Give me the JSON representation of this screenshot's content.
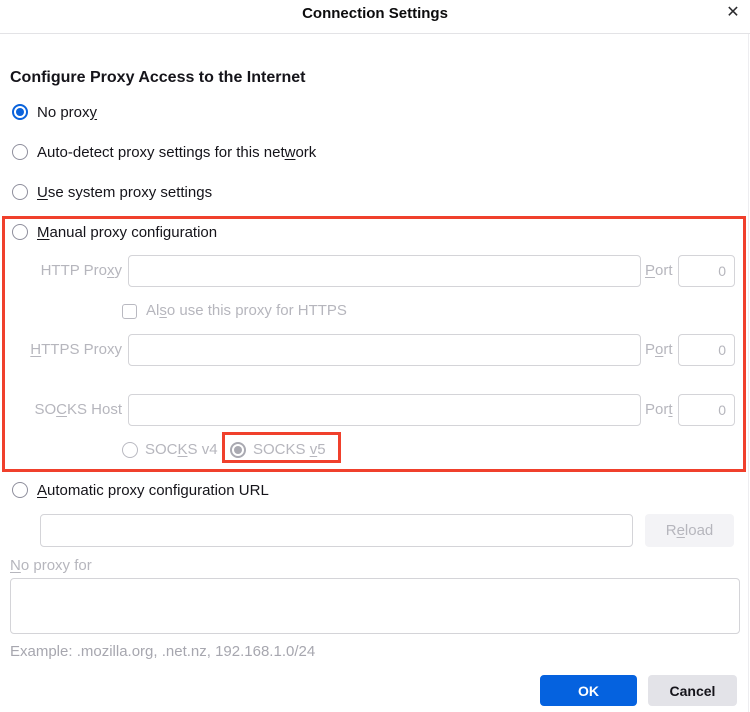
{
  "colors": {
    "accent_blue": "#0562df",
    "annotation_red": "#f0402c",
    "disabled_text": "#b6b6bd",
    "input_border": "#d4d4d8",
    "cancel_bg": "#e3e3e8"
  },
  "header": {
    "title": "Connection Settings",
    "close_icon": "✕"
  },
  "main": {
    "heading": "Configure Proxy Access to the Internet",
    "options": {
      "no_proxy": {
        "pre": "No prox",
        "key": "y",
        "post": "",
        "selected": true
      },
      "auto_detect": {
        "pre": "Auto-detect proxy settings for this net",
        "key": "w",
        "post": "ork",
        "selected": false
      },
      "use_system": {
        "pre": "",
        "key": "U",
        "post": "se system proxy settings",
        "selected": false
      },
      "manual": {
        "pre": "",
        "key": "M",
        "post": "anual proxy configuration",
        "selected": false
      },
      "auto_url": {
        "pre": "",
        "key": "A",
        "post": "utomatic proxy configuration URL",
        "selected": false
      }
    },
    "manual_section": {
      "http": {
        "label_pre": "HTTP Pro",
        "label_key": "x",
        "label_post": "y",
        "value": "",
        "port_pre": "",
        "port_key": "P",
        "port_post": "ort",
        "port_value": "0"
      },
      "https_checkbox": {
        "pre": "Al",
        "key": "s",
        "post": "o use this proxy for HTTPS",
        "checked": false
      },
      "https": {
        "label_pre": "",
        "label_key": "H",
        "label_post": "TTPS Proxy",
        "value": "",
        "port_pre": "P",
        "port_key": "o",
        "port_post": "rt",
        "port_value": "0"
      },
      "socks": {
        "label_pre": "SO",
        "label_key": "C",
        "label_post": "KS Host",
        "value": "",
        "port_pre": "Por",
        "port_key": "t",
        "port_post": "",
        "port_value": "0"
      },
      "socks_v4": {
        "pre": "SOC",
        "key": "K",
        "post": "S v4",
        "selected": false
      },
      "socks_v5": {
        "pre": "SOCKS ",
        "key": "v",
        "post": "5",
        "selected": true
      }
    },
    "auto_section": {
      "url_value": "",
      "reload_pre": "R",
      "reload_key": "e",
      "reload_post": "load"
    },
    "no_proxy_for": {
      "label_pre": "",
      "label_key": "N",
      "label_post": "o proxy for",
      "value": "",
      "example": "Example: .mozilla.org, .net.nz, 192.168.1.0/24"
    }
  },
  "footer": {
    "ok": "OK",
    "cancel": "Cancel"
  }
}
